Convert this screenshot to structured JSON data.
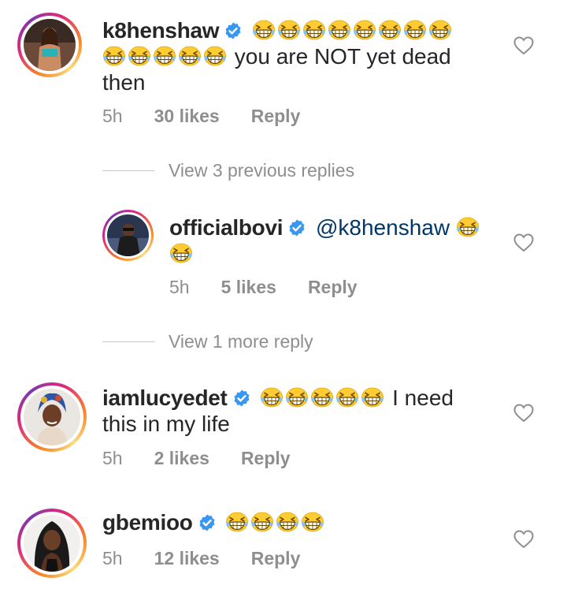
{
  "colors": {
    "text": "#262626",
    "secondary": "#8e8e8e",
    "mention": "#00376b",
    "verified": "#3897f0",
    "emoji_face": "#ffcc33"
  },
  "icons": {
    "verified": "verified-badge-icon",
    "like": "heart-outline-icon",
    "emoji": "grinning-squinting-face-emoji"
  },
  "comments": [
    {
      "username": "k8henshaw",
      "verified": true,
      "emoji_count_line1": 8,
      "emoji_count_line2": 5,
      "text": "you are NOT yet dead",
      "text_cont": "then",
      "time": "5h",
      "likes": "30 likes",
      "reply": "Reply",
      "view_replies": "View 3 previous replies"
    },
    {
      "username": "officialbovi",
      "verified": true,
      "mention": "@k8henshaw",
      "emoji_count": 2,
      "time": "5h",
      "likes": "5 likes",
      "reply": "Reply",
      "view_replies": "View 1 more reply"
    },
    {
      "username": "iamlucyedet",
      "verified": true,
      "emoji_count": 5,
      "text": "I need",
      "text_cont": "this in my life",
      "time": "5h",
      "likes": "2 likes",
      "reply": "Reply"
    },
    {
      "username": "gbemioo",
      "verified": true,
      "emoji_count": 4,
      "time": "5h",
      "likes": "12 likes",
      "reply": "Reply"
    }
  ]
}
